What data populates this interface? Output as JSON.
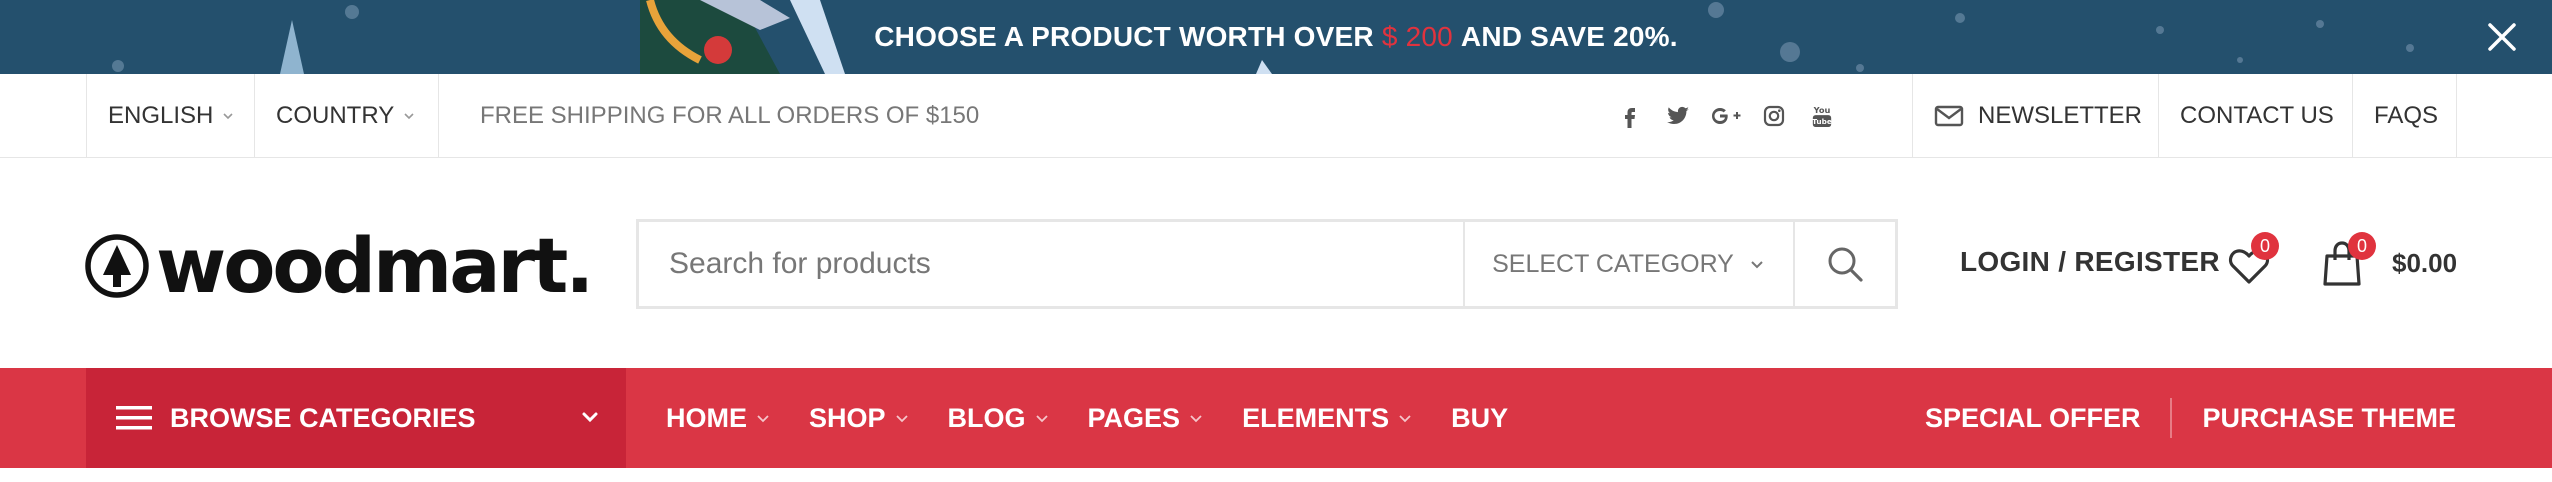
{
  "promo": {
    "prefix": "CHOOSE A PRODUCT WORTH OVER",
    "amount": "$ 200",
    "suffix": "AND SAVE 20%.",
    "close_icon": "close-icon",
    "colors": {
      "background": "#24506d",
      "accent": "#e0333e"
    }
  },
  "topbar": {
    "language": "ENGLISH",
    "country": "COUNTRY",
    "shipping": "FREE SHIPPING FOR ALL ORDERS OF $150",
    "social_icons": [
      "facebook-icon",
      "twitter-icon",
      "google-plus-icon",
      "instagram-icon",
      "youtube-icon"
    ],
    "newsletter": "NEWSLETTER",
    "contact": "CONTACT US",
    "faqs": "FAQS"
  },
  "header": {
    "logo_text": "woodmart.",
    "search": {
      "placeholder": "Search for products",
      "category": "SELECT CATEGORY"
    },
    "login": "LOGIN / REGISTER",
    "wishlist_count": "0",
    "cart_count": "0",
    "cart_total": "$0.00"
  },
  "nav": {
    "browse": "BROWSE CATEGORIES",
    "items": [
      {
        "label": "HOME",
        "dropdown": true
      },
      {
        "label": "SHOP",
        "dropdown": true
      },
      {
        "label": "BLOG",
        "dropdown": true
      },
      {
        "label": "PAGES",
        "dropdown": true
      },
      {
        "label": "ELEMENTS",
        "dropdown": true
      },
      {
        "label": "BUY",
        "dropdown": false
      }
    ],
    "special_offer": "SPECIAL OFFER",
    "purchase": "PURCHASE THEME",
    "colors": {
      "bar": "#da3645",
      "browse": "#c82438"
    }
  }
}
